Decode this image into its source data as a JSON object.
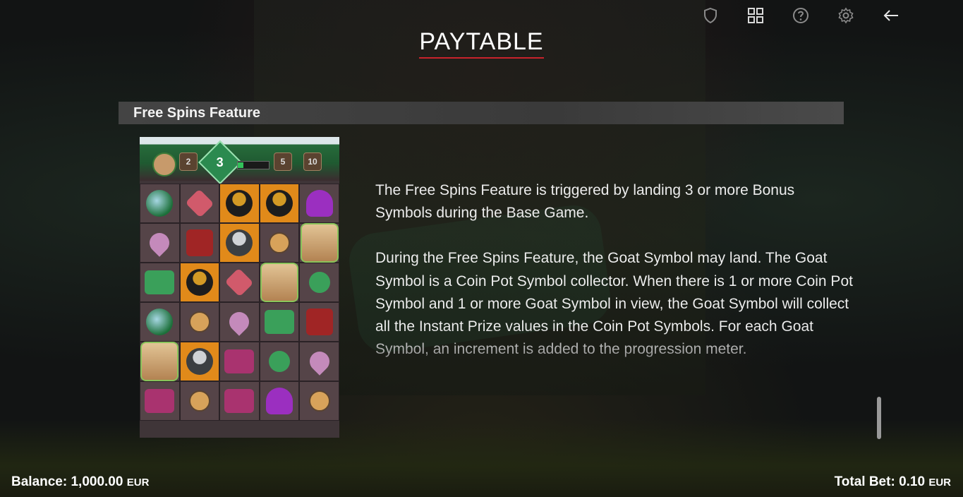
{
  "title": "PAYTABLE",
  "toolbar": {
    "icons": [
      "shield-icon",
      "grid-icon",
      "help-icon",
      "settings-icon",
      "back-arrow-icon"
    ]
  },
  "section": {
    "header": "Free Spins Feature",
    "paragraphs": [
      "The Free Spins Feature is triggered by landing 3 or more Bonus Symbols during the Base Game.",
      "During the Free Spins Feature, the Goat Symbol may land. The Goat Symbol is a Coin Pot Symbol collector. When there is 1 or more Coin Pot Symbol and 1 or more Goat Symbol in view, the Goat Symbol will collect all the Instant Prize values in the Coin Pot Symbols. For each Goat Symbol, an increment is added to the progression meter."
    ]
  },
  "preview": {
    "meter": {
      "chip_1": "2",
      "gem": "3",
      "chip_2": "5",
      "chip_3": "10"
    },
    "grid_symbols": [
      "egg",
      "heart",
      "pot",
      "pot",
      "mush",
      "spade",
      "ruby",
      "potg",
      "dia",
      "goat",
      "chest",
      "pot",
      "heart",
      "goat",
      "club",
      "egg",
      "dia",
      "spade",
      "chest",
      "ruby",
      "goat",
      "potg",
      "chestp",
      "club",
      "spade",
      "chestp",
      "dia",
      "chestp",
      "mush",
      "dia"
    ],
    "orange_cells": [
      2,
      3,
      7,
      11,
      21
    ]
  },
  "footer": {
    "balance_label": "Balance:",
    "balance_value": "1,000.00",
    "balance_currency": "EUR",
    "bet_label": "Total Bet:",
    "bet_value": "0.10",
    "bet_currency": "EUR"
  }
}
